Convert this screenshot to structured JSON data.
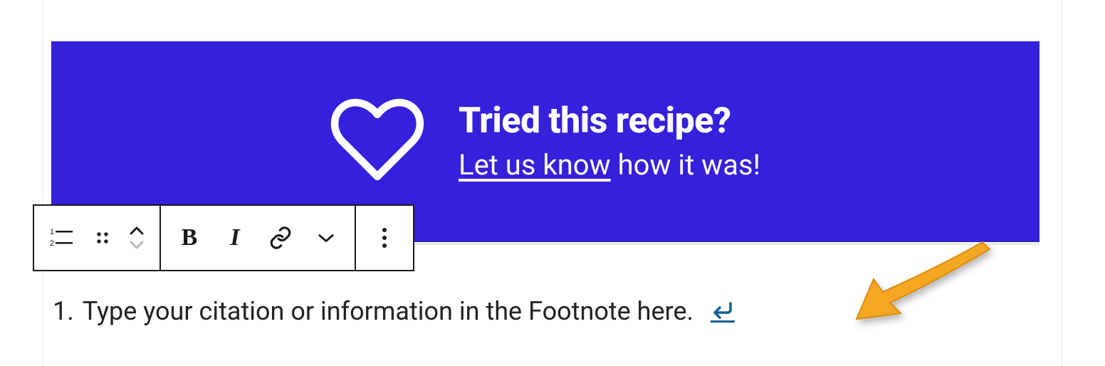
{
  "banner": {
    "title": "Tried this recipe?",
    "link_text": "Let us know",
    "tail_text": " how it was!"
  },
  "footnote": {
    "number": "1.",
    "text": "Type your citation or information in the Footnote here."
  }
}
